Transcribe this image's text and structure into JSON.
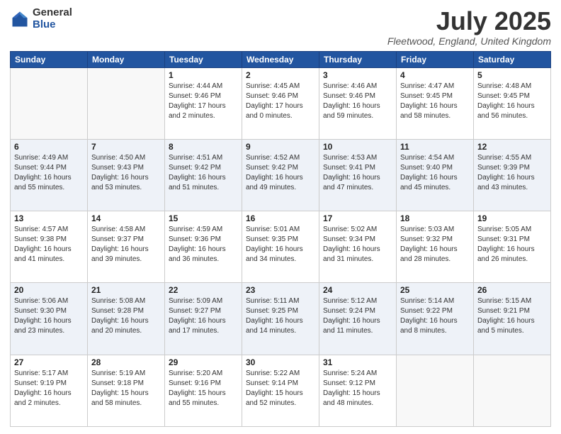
{
  "logo": {
    "general": "General",
    "blue": "Blue"
  },
  "title": "July 2025",
  "location": "Fleetwood, England, United Kingdom",
  "days_of_week": [
    "Sunday",
    "Monday",
    "Tuesday",
    "Wednesday",
    "Thursday",
    "Friday",
    "Saturday"
  ],
  "weeks": [
    [
      {
        "day": "",
        "sunrise": "",
        "sunset": "",
        "daylight": ""
      },
      {
        "day": "",
        "sunrise": "",
        "sunset": "",
        "daylight": ""
      },
      {
        "day": "1",
        "sunrise": "Sunrise: 4:44 AM",
        "sunset": "Sunset: 9:46 PM",
        "daylight": "Daylight: 17 hours and 2 minutes."
      },
      {
        "day": "2",
        "sunrise": "Sunrise: 4:45 AM",
        "sunset": "Sunset: 9:46 PM",
        "daylight": "Daylight: 17 hours and 0 minutes."
      },
      {
        "day": "3",
        "sunrise": "Sunrise: 4:46 AM",
        "sunset": "Sunset: 9:46 PM",
        "daylight": "Daylight: 16 hours and 59 minutes."
      },
      {
        "day": "4",
        "sunrise": "Sunrise: 4:47 AM",
        "sunset": "Sunset: 9:45 PM",
        "daylight": "Daylight: 16 hours and 58 minutes."
      },
      {
        "day": "5",
        "sunrise": "Sunrise: 4:48 AM",
        "sunset": "Sunset: 9:45 PM",
        "daylight": "Daylight: 16 hours and 56 minutes."
      }
    ],
    [
      {
        "day": "6",
        "sunrise": "Sunrise: 4:49 AM",
        "sunset": "Sunset: 9:44 PM",
        "daylight": "Daylight: 16 hours and 55 minutes."
      },
      {
        "day": "7",
        "sunrise": "Sunrise: 4:50 AM",
        "sunset": "Sunset: 9:43 PM",
        "daylight": "Daylight: 16 hours and 53 minutes."
      },
      {
        "day": "8",
        "sunrise": "Sunrise: 4:51 AM",
        "sunset": "Sunset: 9:42 PM",
        "daylight": "Daylight: 16 hours and 51 minutes."
      },
      {
        "day": "9",
        "sunrise": "Sunrise: 4:52 AM",
        "sunset": "Sunset: 9:42 PM",
        "daylight": "Daylight: 16 hours and 49 minutes."
      },
      {
        "day": "10",
        "sunrise": "Sunrise: 4:53 AM",
        "sunset": "Sunset: 9:41 PM",
        "daylight": "Daylight: 16 hours and 47 minutes."
      },
      {
        "day": "11",
        "sunrise": "Sunrise: 4:54 AM",
        "sunset": "Sunset: 9:40 PM",
        "daylight": "Daylight: 16 hours and 45 minutes."
      },
      {
        "day": "12",
        "sunrise": "Sunrise: 4:55 AM",
        "sunset": "Sunset: 9:39 PM",
        "daylight": "Daylight: 16 hours and 43 minutes."
      }
    ],
    [
      {
        "day": "13",
        "sunrise": "Sunrise: 4:57 AM",
        "sunset": "Sunset: 9:38 PM",
        "daylight": "Daylight: 16 hours and 41 minutes."
      },
      {
        "day": "14",
        "sunrise": "Sunrise: 4:58 AM",
        "sunset": "Sunset: 9:37 PM",
        "daylight": "Daylight: 16 hours and 39 minutes."
      },
      {
        "day": "15",
        "sunrise": "Sunrise: 4:59 AM",
        "sunset": "Sunset: 9:36 PM",
        "daylight": "Daylight: 16 hours and 36 minutes."
      },
      {
        "day": "16",
        "sunrise": "Sunrise: 5:01 AM",
        "sunset": "Sunset: 9:35 PM",
        "daylight": "Daylight: 16 hours and 34 minutes."
      },
      {
        "day": "17",
        "sunrise": "Sunrise: 5:02 AM",
        "sunset": "Sunset: 9:34 PM",
        "daylight": "Daylight: 16 hours and 31 minutes."
      },
      {
        "day": "18",
        "sunrise": "Sunrise: 5:03 AM",
        "sunset": "Sunset: 9:32 PM",
        "daylight": "Daylight: 16 hours and 28 minutes."
      },
      {
        "day": "19",
        "sunrise": "Sunrise: 5:05 AM",
        "sunset": "Sunset: 9:31 PM",
        "daylight": "Daylight: 16 hours and 26 minutes."
      }
    ],
    [
      {
        "day": "20",
        "sunrise": "Sunrise: 5:06 AM",
        "sunset": "Sunset: 9:30 PM",
        "daylight": "Daylight: 16 hours and 23 minutes."
      },
      {
        "day": "21",
        "sunrise": "Sunrise: 5:08 AM",
        "sunset": "Sunset: 9:28 PM",
        "daylight": "Daylight: 16 hours and 20 minutes."
      },
      {
        "day": "22",
        "sunrise": "Sunrise: 5:09 AM",
        "sunset": "Sunset: 9:27 PM",
        "daylight": "Daylight: 16 hours and 17 minutes."
      },
      {
        "day": "23",
        "sunrise": "Sunrise: 5:11 AM",
        "sunset": "Sunset: 9:25 PM",
        "daylight": "Daylight: 16 hours and 14 minutes."
      },
      {
        "day": "24",
        "sunrise": "Sunrise: 5:12 AM",
        "sunset": "Sunset: 9:24 PM",
        "daylight": "Daylight: 16 hours and 11 minutes."
      },
      {
        "day": "25",
        "sunrise": "Sunrise: 5:14 AM",
        "sunset": "Sunset: 9:22 PM",
        "daylight": "Daylight: 16 hours and 8 minutes."
      },
      {
        "day": "26",
        "sunrise": "Sunrise: 5:15 AM",
        "sunset": "Sunset: 9:21 PM",
        "daylight": "Daylight: 16 hours and 5 minutes."
      }
    ],
    [
      {
        "day": "27",
        "sunrise": "Sunrise: 5:17 AM",
        "sunset": "Sunset: 9:19 PM",
        "daylight": "Daylight: 16 hours and 2 minutes."
      },
      {
        "day": "28",
        "sunrise": "Sunrise: 5:19 AM",
        "sunset": "Sunset: 9:18 PM",
        "daylight": "Daylight: 15 hours and 58 minutes."
      },
      {
        "day": "29",
        "sunrise": "Sunrise: 5:20 AM",
        "sunset": "Sunset: 9:16 PM",
        "daylight": "Daylight: 15 hours and 55 minutes."
      },
      {
        "day": "30",
        "sunrise": "Sunrise: 5:22 AM",
        "sunset": "Sunset: 9:14 PM",
        "daylight": "Daylight: 15 hours and 52 minutes."
      },
      {
        "day": "31",
        "sunrise": "Sunrise: 5:24 AM",
        "sunset": "Sunset: 9:12 PM",
        "daylight": "Daylight: 15 hours and 48 minutes."
      },
      {
        "day": "",
        "sunrise": "",
        "sunset": "",
        "daylight": ""
      },
      {
        "day": "",
        "sunrise": "",
        "sunset": "",
        "daylight": ""
      }
    ]
  ]
}
